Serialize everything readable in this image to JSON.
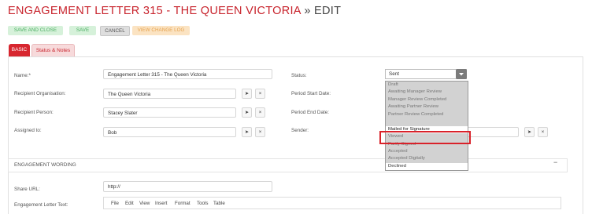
{
  "header": {
    "title": "ENGAGEMENT LETTER 315 - THE QUEEN VICTORIA",
    "suffix": "» EDIT"
  },
  "toolbar": {
    "save_close": "SAVE AND CLOSE",
    "save": "SAVE",
    "cancel": "CANCEL",
    "change_log": "VIEW CHANGE LOG"
  },
  "tabs": {
    "basic": "BASIC",
    "status_notes": "Status & Notes"
  },
  "form": {
    "name_label": "Name:*",
    "name_value": "Engagement Letter 315 - The Queen Victoria",
    "org_label": "Recipient Organisation:",
    "org_value": "The Queen Victoria",
    "person_label": "Recipient Person:",
    "person_value": "Stacey Slater",
    "assigned_label": "Assigned to:",
    "assigned_value": "Bob",
    "status_label": "Status:",
    "status_value": "Sent",
    "start_label": "Period Start Date:",
    "end_label": "Period End Date:",
    "sender_label": "Sender:"
  },
  "status_options": [
    "Draft",
    "Awaiting Manager Review",
    "Manager Review Completed",
    "Awaiting Partner Review",
    "Partner Review Completed",
    "Sent",
    "Mailed for Signature",
    "Viewed",
    "Partly Signed",
    "Accepted",
    "Accepted Digitally",
    "Declined"
  ],
  "section": {
    "title": "ENGAGEMENT WORDING",
    "toggle": "−",
    "share_label": "Share URL:",
    "share_value": "http://",
    "letter_label": "Engagement Letter Text:"
  },
  "editor_menu": [
    "File",
    "Edit",
    "View",
    "Insert",
    "Format",
    "Tools",
    "Table"
  ],
  "icons": {
    "pick": "cursor-icon",
    "clear": "x-icon"
  },
  "colors": {
    "accent": "#c8232c",
    "save_bg": "#d6f1da",
    "log_bg": "#fbe3c2",
    "highlight": "#d9222a"
  }
}
